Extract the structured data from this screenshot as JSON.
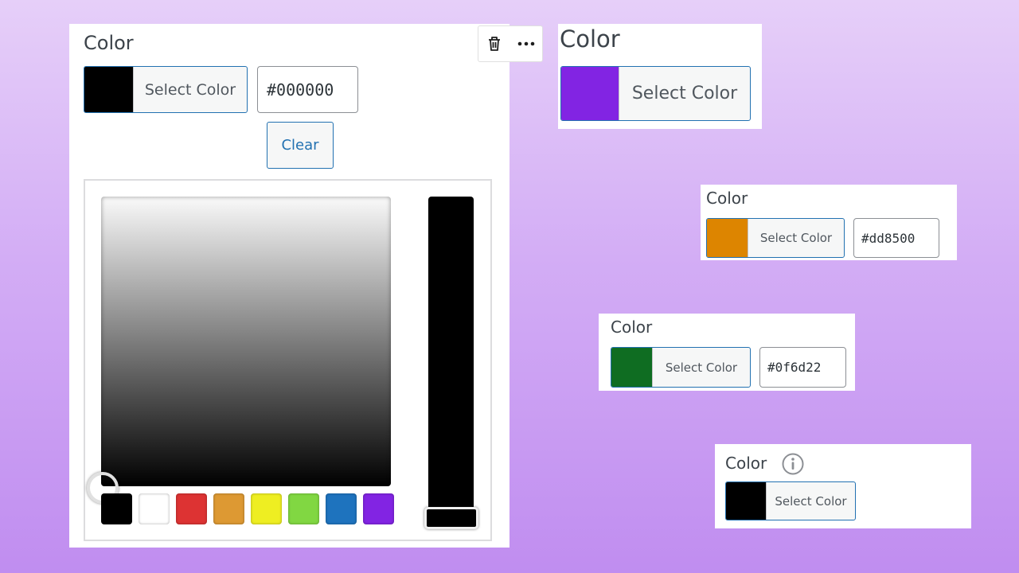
{
  "widgets": {
    "main": {
      "label": "Color",
      "select_label": "Select Color",
      "swatch_color": "#000000",
      "hex_value": "#000000",
      "clear_label": "Clear",
      "toolbar": {
        "delete_icon": "trash-icon",
        "more_icon": "ellipsis-icon"
      },
      "palette": [
        "#000000",
        "#ffffff",
        "#dd3333",
        "#dd9933",
        "#eeee22",
        "#81d742",
        "#1e73be",
        "#8224e3"
      ]
    },
    "large": {
      "label": "Color",
      "select_label": "Select Color",
      "swatch_color": "#8224e3"
    },
    "orange": {
      "label": "Color",
      "select_label": "Select Color",
      "swatch_color": "#dd8500",
      "hex_value": "#dd8500"
    },
    "green": {
      "label": "Color",
      "select_label": "Select Color",
      "swatch_color": "#0f6d22",
      "hex_value": "#0f6d22"
    },
    "info": {
      "label": "Color",
      "select_label": "Select Color",
      "swatch_color": "#000000",
      "info_icon": "info-icon"
    }
  }
}
